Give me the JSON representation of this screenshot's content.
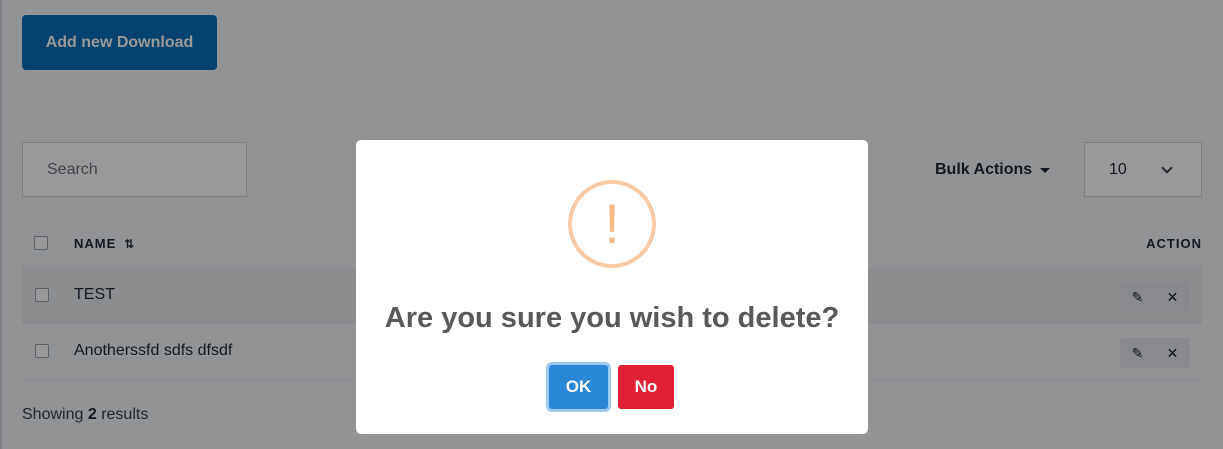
{
  "toolbar": {
    "add_label": "Add new Download",
    "search_placeholder": "Search",
    "bulk_label": "Bulk Actions",
    "per_page_value": "10"
  },
  "table": {
    "headers": {
      "name": "NAME",
      "action": "ACTION"
    },
    "rows": [
      {
        "name": "TEST"
      },
      {
        "name": "Anotherssfd sdfs dfsdf"
      }
    ]
  },
  "footer": {
    "showing_prefix": "Showing",
    "count": "2",
    "showing_suffix": "results"
  },
  "dialog": {
    "icon_glyph": "!",
    "message": "Are you sure you wish to delete?",
    "ok_label": "OK",
    "no_label": "No"
  },
  "colors": {
    "primary": "#0b6fb8",
    "ok": "#2b87d8",
    "no": "#e02034",
    "warning": "#f8bb86"
  }
}
